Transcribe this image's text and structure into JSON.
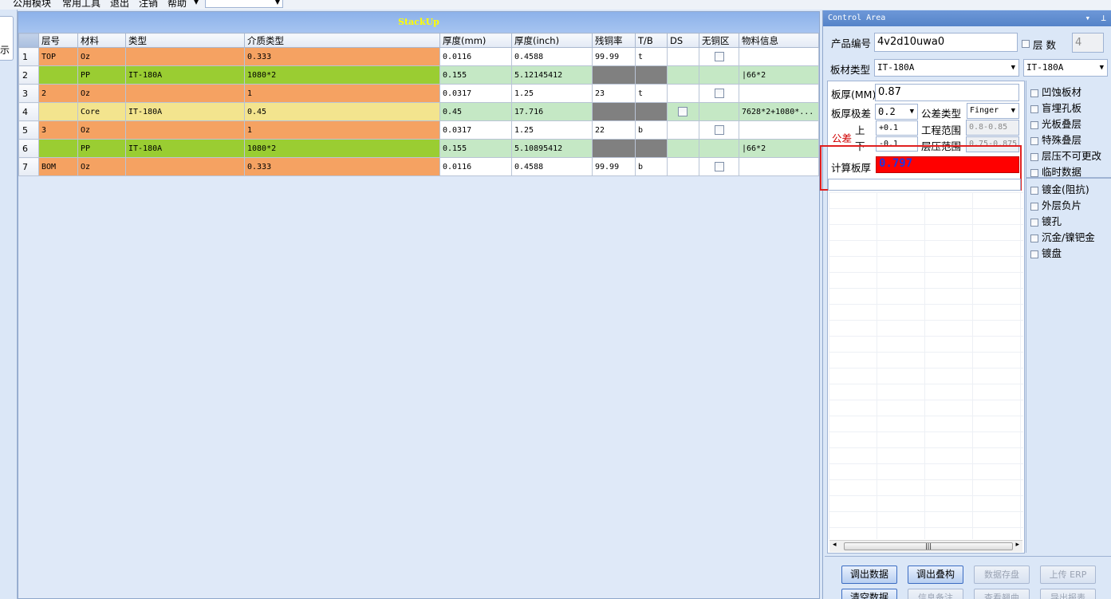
{
  "menu": {
    "items": [
      "公用模块",
      "常用工具",
      "退出",
      "注销",
      "帮助"
    ],
    "combo_value": ""
  },
  "left_tab": {
    "label": "示"
  },
  "stackup": {
    "title": "StackUp",
    "columns": [
      "层号",
      "材料",
      "类型",
      "介质类型",
      "厚度(mm)",
      "厚度(inch)",
      "残铜率",
      "T/B",
      "DS",
      "无铜区",
      "物料信息"
    ],
    "rows": [
      {
        "num": "1",
        "layer": "TOP",
        "material": "Oz",
        "type": "",
        "dielectric": "0.333",
        "mm": "0.0116",
        "inch": "0.4588",
        "copper": "99.99",
        "tb": "t",
        "info": ""
      },
      {
        "num": "2",
        "layer": "",
        "material": "PP",
        "type": "IT-180A",
        "dielectric": "1080*2",
        "mm": "0.155",
        "inch": "5.12145412",
        "copper": "",
        "tb": "",
        "info": "|66*2"
      },
      {
        "num": "3",
        "layer": "2",
        "material": "Oz",
        "type": "",
        "dielectric": "1",
        "mm": "0.0317",
        "inch": "1.25",
        "copper": "23",
        "tb": "t",
        "info": ""
      },
      {
        "num": "4",
        "layer": "",
        "material": "Core",
        "type": "IT-180A",
        "dielectric": "0.45",
        "mm": "0.45",
        "inch": "17.716",
        "copper": "",
        "tb": "",
        "info": "7628*2+1080*..."
      },
      {
        "num": "5",
        "layer": "3",
        "material": "Oz",
        "type": "",
        "dielectric": "1",
        "mm": "0.0317",
        "inch": "1.25",
        "copper": "22",
        "tb": "b",
        "info": ""
      },
      {
        "num": "6",
        "layer": "",
        "material": "PP",
        "type": "IT-180A",
        "dielectric": "1080*2",
        "mm": "0.155",
        "inch": "5.10895412",
        "copper": "",
        "tb": "",
        "info": "|66*2"
      },
      {
        "num": "7",
        "layer": "BOM",
        "material": "Oz",
        "type": "",
        "dielectric": "0.333",
        "mm": "0.0116",
        "inch": "0.4588",
        "copper": "99.99",
        "tb": "b",
        "info": ""
      }
    ]
  },
  "control": {
    "title": "Control Area",
    "product_label": "产品编号",
    "product_value": "4v2d10uwa0",
    "layers_label": "层 数",
    "layers_value": "4",
    "board_type_label": "板材类型",
    "board_type_value": "IT-180A",
    "board_type_value2": "IT-180A",
    "thickness_label": "板厚(MM)",
    "thickness_value": "0.87",
    "grade_label": "板厚极差",
    "grade_value": "0.2",
    "tol_type_label": "公差类型",
    "tol_type_value": "Finger",
    "tol_label": "公差",
    "upper_label": "上",
    "lower_label": "下",
    "upper_value": "+0.1",
    "lower_value": "-0.1",
    "eng_range_label": "工程范围",
    "eng_range_value": "0.8-0.85",
    "press_range_label": "层压范围",
    "press_range_value": "0.75-0.875",
    "calc_label": "计算板厚",
    "calc_value": "0.797"
  },
  "options": [
    "凹蚀板材",
    "盲埋孔板",
    "光板叠层",
    "特殊叠层",
    "层压不可更改",
    "临时数据",
    "镀金(阻抗)",
    "外层负片",
    "镀孔",
    "沉金/镍钯金",
    "镀盘"
  ],
  "buttons": {
    "export_data": "调出数据",
    "export_stack": "调出叠构",
    "save_data": "数据存盘",
    "upload_erp": "上传 ERP",
    "clear_data": "清空数据",
    "info_notes": "信息备注",
    "view_warp": "查看翘曲",
    "export_report": "导出报表"
  },
  "colors": {
    "copper_row": "#f5a262",
    "pp_row": "#9acd32",
    "core_row": "#f3e48e",
    "green_light": "#c5e8c5",
    "calc_bg": "#ff0000",
    "highlight_border": "#e02020",
    "title_text": "#ffff00"
  }
}
